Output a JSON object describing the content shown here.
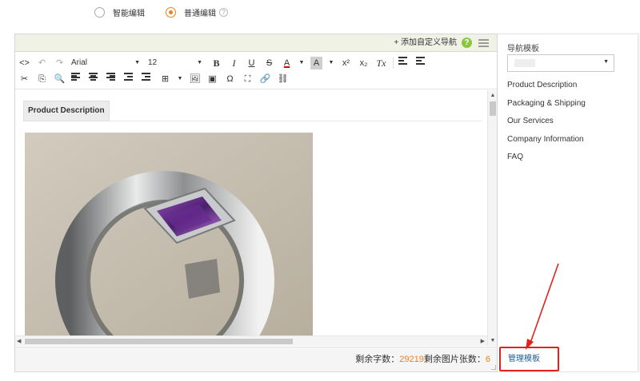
{
  "mode": {
    "smart_label": "智能编辑",
    "normal_label": "普通编辑",
    "selected": "normal"
  },
  "nav_bar": {
    "add_custom_nav": "+ 添加自定义导航",
    "help_glyph": "?"
  },
  "toolbar": {
    "font_family": "Arial",
    "font_size": "12",
    "bold": "B",
    "italic": "I",
    "underline": "U",
    "strike": "S",
    "font_color": "A",
    "bg_color": "A",
    "superscript": "x²",
    "subscript": "x₂",
    "clear_format": "Tx",
    "special_char": "Ω",
    "source_glyph": "<>",
    "undo_glyph": "↶",
    "redo_glyph": "↷",
    "cut_glyph": "✂",
    "copy_glyph": "⎘",
    "find_glyph": "🔍",
    "table_glyph": "⊞",
    "image_glyph": "🖼",
    "preview_glyph": "▣",
    "fullscreen_glyph": "⛶",
    "link_glyph": "🔗",
    "unlink_glyph": "⛓",
    "dropdown_glyph": "▼"
  },
  "content": {
    "section_tab": "Product Description",
    "image_subject": "ring-photo"
  },
  "status": {
    "chars_label": "剩余字数：",
    "chars_value": "29219",
    "images_label": "剩余图片张数：",
    "images_value": "6"
  },
  "panel": {
    "title": "导航模板",
    "select_value": "",
    "items": [
      "Product Description",
      "Packaging & Shipping",
      "Our Services",
      "Company Information",
      "FAQ"
    ],
    "manage_label": "管理模板"
  },
  "colors": {
    "accent_orange": "#f07f1a",
    "help_green": "#8cc63f",
    "highlight_red": "#e2231a",
    "link_blue": "#1f5b9a",
    "nav_bar_bg": "#f0f2e6"
  }
}
